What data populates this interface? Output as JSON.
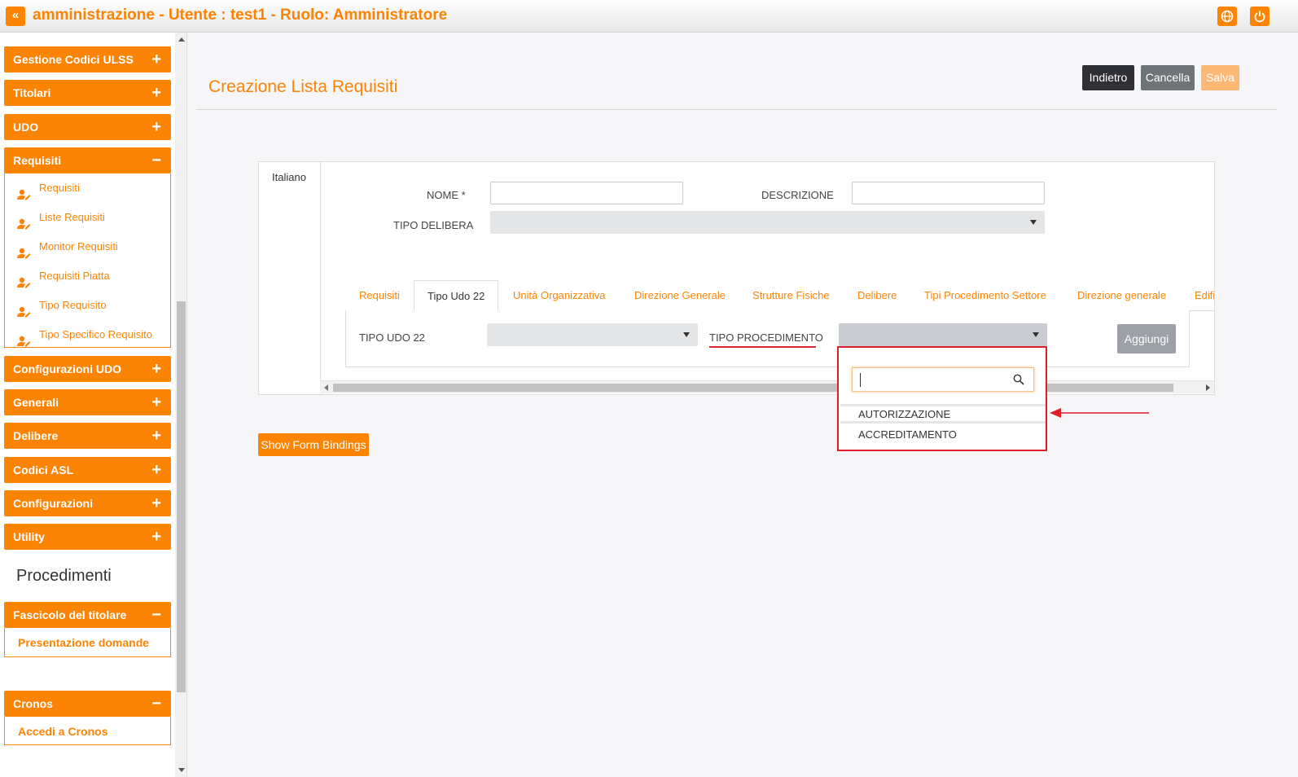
{
  "topbar": {
    "title": "amministrazione - Utente : test1 - Ruolo: Amministratore"
  },
  "sidebar": {
    "groups": [
      {
        "label": "Gestione Codici ULSS",
        "sign": "+"
      },
      {
        "label": "Titolari",
        "sign": "+"
      },
      {
        "label": "UDO",
        "sign": "+"
      },
      {
        "label": "Requisiti",
        "sign": "−"
      },
      {
        "label": "Configurazioni UDO",
        "sign": "+"
      },
      {
        "label": "Generali",
        "sign": "+"
      },
      {
        "label": "Delibere",
        "sign": "+"
      },
      {
        "label": "Codici ASL",
        "sign": "+"
      },
      {
        "label": "Configurazioni",
        "sign": "+"
      },
      {
        "label": "Utility",
        "sign": "+"
      }
    ],
    "requisiti_items": [
      "Requisiti",
      "Liste Requisiti",
      "Monitor Requisiti",
      "Requisiti Piatta",
      "Tipo Requisito",
      "Tipo Specifico Requisito"
    ],
    "section_title": "Procedimenti",
    "fascicolo": {
      "label": "Fascicolo del titolare",
      "sign": "−",
      "item": "Presentazione domande"
    },
    "cronos": {
      "label": "Cronos",
      "sign": "−",
      "item": "Accedi a Cronos"
    }
  },
  "page": {
    "title": "Creazione Lista Requisiti",
    "buttons": {
      "back": "Indietro",
      "cancel": "Cancella",
      "save": "Salva"
    }
  },
  "form": {
    "lang_tab": "Italiano",
    "nome_label": "NOME *",
    "descrizione_label": "DESCRIZIONE",
    "tipo_delibera_label": "TIPO DELIBERA",
    "tabs": [
      "Requisiti",
      "Tipo Udo 22",
      "Unità Organizzativa",
      "Direzione Generale",
      "Strutture Fisiche",
      "Delibere",
      "Tipi Procedimento Settore",
      "Direzione generale",
      "Edifi"
    ],
    "tipo_udo_label": "TIPO UDO 22",
    "tipo_procedimento_label": "TIPO PROCEDIMENTO",
    "add_button": "Aggiungi"
  },
  "dropdown": {
    "options": [
      "AUTORIZZAZIONE",
      "ACCREDITAMENTO"
    ]
  },
  "footer": {
    "bindings_button": "Show Form Bindings"
  },
  "colors": {
    "accent": "#fc8405",
    "highlight": "#dd1f2b"
  }
}
